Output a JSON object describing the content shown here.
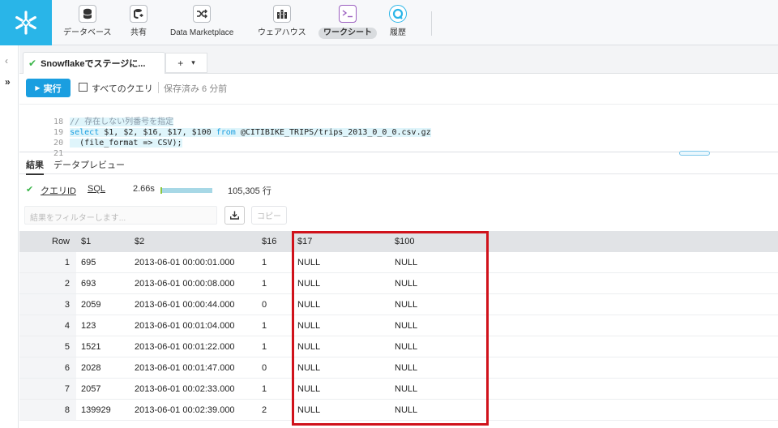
{
  "nav": {
    "items": [
      {
        "label": "データベース",
        "icon": "database-icon"
      },
      {
        "label": "共有",
        "icon": "shared-data-icon"
      },
      {
        "label": "Data Marketplace",
        "icon": "marketplace-icon"
      },
      {
        "label": "ウェアハウス",
        "icon": "warehouse-icon"
      },
      {
        "label": "ワークシート",
        "icon": "worksheet-icon",
        "active": true
      },
      {
        "label": "履歴",
        "icon": "history-icon"
      }
    ]
  },
  "tabs": {
    "worksheet_label": "Snowflakeでステージに...",
    "add": "+",
    "menu": "▾"
  },
  "toolbar": {
    "run_label": "実行",
    "all_queries_label": "すべてのクエリ",
    "saved_text": "保存済み 6 分前"
  },
  "editor": {
    "lines": [
      {
        "num": "18",
        "comment": "// 存在しない列番号を指定",
        "kw1": "",
        "code1": "",
        "kw2": "",
        "code2": ""
      },
      {
        "num": "19",
        "comment": "",
        "kw1": "select",
        "code1": " $1, $2, $16, $17, $100 ",
        "kw2": "from",
        "code2": " @CITIBIKE_TRIPS/trips_2013_0_0_0.csv.gz"
      },
      {
        "num": "20",
        "comment": "",
        "kw1": "",
        "code1": "  (file_format => CSV);",
        "kw2": "",
        "code2": ""
      },
      {
        "num": "21",
        "comment": "",
        "kw1": "",
        "code1": "",
        "kw2": "",
        "code2": ""
      }
    ]
  },
  "results": {
    "tab_results": "結果",
    "tab_preview": "データプレビュー",
    "query_id_label": "クエリID",
    "sql_label": "SQL",
    "duration": "2.66s",
    "row_count": "105,305 行",
    "filter_placeholder": "結果をフィルターします...",
    "copy_label": "コピー"
  },
  "grid": {
    "columns": [
      "Row",
      "$1",
      "$2",
      "$16",
      "$17",
      "$100"
    ],
    "rows": [
      [
        "1",
        "695",
        "2013-06-01 00:00:01.000",
        "1",
        "NULL",
        "NULL"
      ],
      [
        "2",
        "693",
        "2013-06-01 00:00:08.000",
        "1",
        "NULL",
        "NULL"
      ],
      [
        "3",
        "2059",
        "2013-06-01 00:00:44.000",
        "0",
        "NULL",
        "NULL"
      ],
      [
        "4",
        "123",
        "2013-06-01 00:01:04.000",
        "1",
        "NULL",
        "NULL"
      ],
      [
        "5",
        "1521",
        "2013-06-01 00:01:22.000",
        "1",
        "NULL",
        "NULL"
      ],
      [
        "6",
        "2028",
        "2013-06-01 00:01:47.000",
        "0",
        "NULL",
        "NULL"
      ],
      [
        "7",
        "2057",
        "2013-06-01 00:02:33.000",
        "1",
        "NULL",
        "NULL"
      ],
      [
        "8",
        "139929",
        "2013-06-01 00:02:39.000",
        "2",
        "NULL",
        "NULL"
      ]
    ]
  },
  "colors": {
    "brand": "#29b5e8",
    "run_button": "#1a9ee0",
    "highlight_box": "#d0121b"
  }
}
